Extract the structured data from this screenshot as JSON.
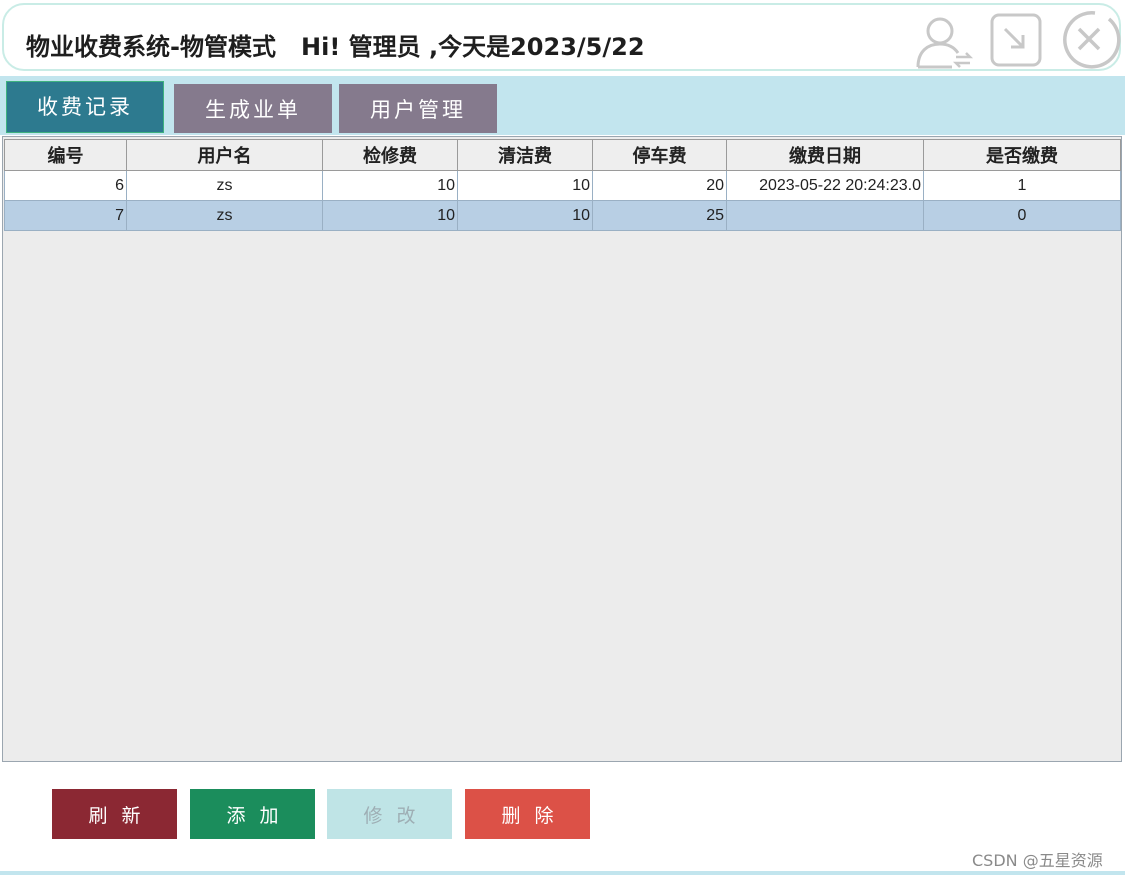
{
  "header": {
    "title": "物业收费系统-物管模式   Hi! 管理员 ,今天是2023/5/22",
    "icons": [
      "switch-user-icon",
      "minimize-icon",
      "close-icon"
    ]
  },
  "tabs": [
    {
      "label": "收费记录",
      "active": true
    },
    {
      "label": "生成业单",
      "active": false
    },
    {
      "label": "用户管理",
      "active": false
    }
  ],
  "table": {
    "columns": [
      "编号",
      "用户名",
      "检修费",
      "清洁费",
      "停车费",
      "缴费日期",
      "是否缴费"
    ],
    "rows": [
      {
        "id": "6",
        "user": "zs",
        "repair": "10",
        "clean": "10",
        "parking": "20",
        "date": "2023-05-22 20:24:23.0",
        "paid": "1"
      },
      {
        "id": "7",
        "user": "zs",
        "repair": "10",
        "clean": "10",
        "parking": "25",
        "date": "",
        "paid": "0"
      }
    ],
    "selected_row": 1
  },
  "buttons": {
    "refresh": "刷新",
    "add": "添加",
    "edit": "修改",
    "delete": "删除"
  },
  "colors": {
    "refresh": "#8b2833",
    "add": "#1b8d5c",
    "edit": "#bfe4e6",
    "delete": "#dc5147",
    "tab_active": "#2d7a8f",
    "tab_inactive": "#857a8d",
    "selection": "#b8cfe4"
  },
  "watermark": "CSDN @五星资源"
}
